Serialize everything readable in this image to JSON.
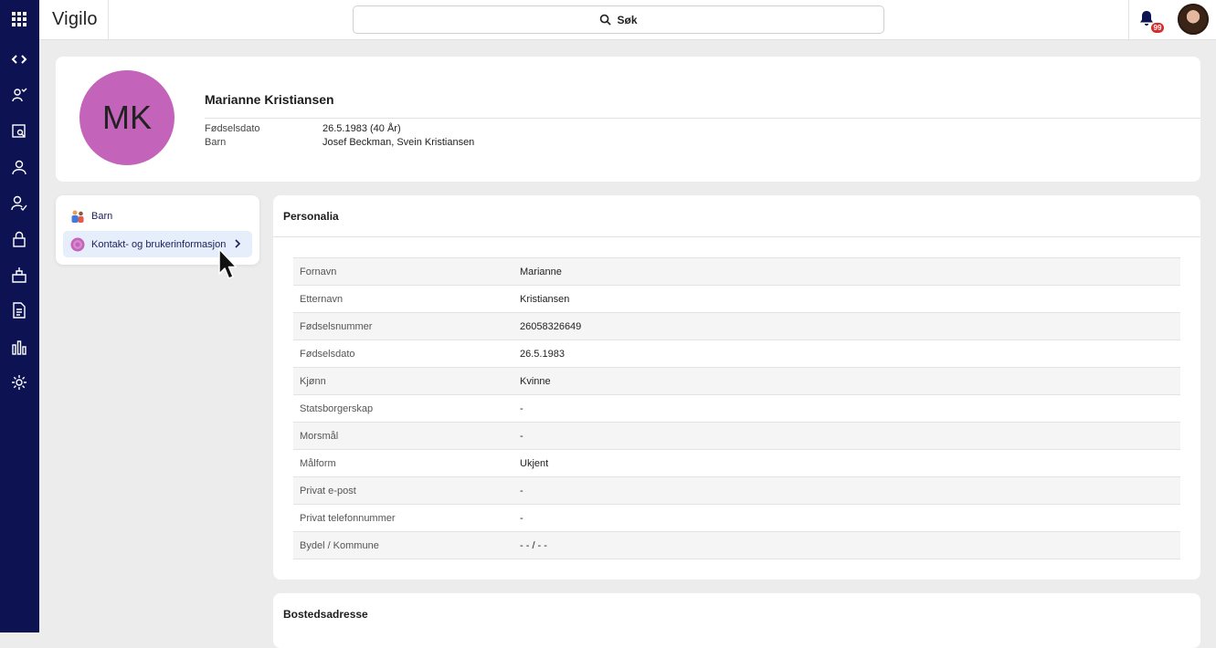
{
  "app": {
    "brand": "Vigilo"
  },
  "search": {
    "label": "Søk"
  },
  "notifications": {
    "count": "99"
  },
  "profile": {
    "initials": "MK",
    "avatar_color": "#c363b9",
    "name": "Marianne Kristiansen",
    "fields": [
      {
        "label": "Fødselsdato",
        "value": "26.5.1983 (40 År)"
      },
      {
        "label": "Barn",
        "value": "Josef Beckman, Svein Kristiansen"
      }
    ]
  },
  "menu": {
    "items": [
      {
        "label": "Barn",
        "icon": "children-icon"
      },
      {
        "label": "Kontakt- og brukerinformasjon",
        "icon": "user-avatar-icon",
        "active": true
      }
    ]
  },
  "personalia": {
    "title": "Personalia",
    "rows": [
      {
        "label": "Fornavn",
        "value": "Marianne"
      },
      {
        "label": "Etternavn",
        "value": "Kristiansen"
      },
      {
        "label": "Fødselsnummer",
        "value": "26058326649"
      },
      {
        "label": "Fødselsdato",
        "value": "26.5.1983"
      },
      {
        "label": "Kjønn",
        "value": "Kvinne"
      },
      {
        "label": "Statsborgerskap",
        "value": "-"
      },
      {
        "label": "Morsmål",
        "value": "-"
      },
      {
        "label": "Målform",
        "value": "Ukjent"
      },
      {
        "label": "Privat e-post",
        "value": "-"
      },
      {
        "label": "Privat telefonnummer",
        "value": "-"
      },
      {
        "label": "Bydel / Kommune",
        "value": "- - / - -"
      }
    ]
  },
  "bostedsadresse": {
    "title": "Bostedsadresse"
  },
  "colors": {
    "rail": "#0d1352",
    "active_item": "#e6eefb",
    "badge": "#d62c2c"
  }
}
